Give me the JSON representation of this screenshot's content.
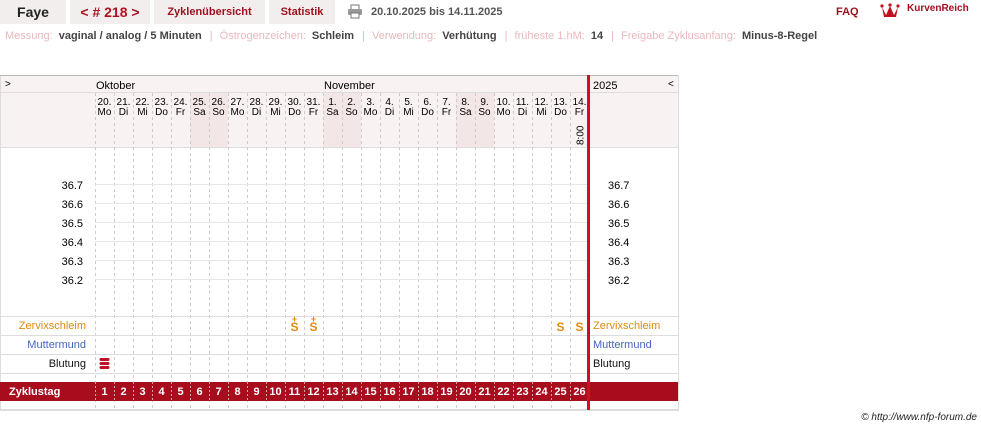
{
  "header": {
    "name": "Faye",
    "cycle_nav": "< # 218 >",
    "tabs": [
      "Zyklenübersicht",
      "Statistik"
    ],
    "date_range": "20.10.2025 bis 14.11.2025",
    "faq": "FAQ",
    "brand": "KurvenReich"
  },
  "info": [
    {
      "label": "Messung:",
      "value": "vaginal / analog / 5 Minuten"
    },
    {
      "label": "Östrogenzeichen:",
      "value": "Schleim"
    },
    {
      "label": "Verwendung:",
      "value": "Verhütung"
    },
    {
      "label": "früheste 1.hM:",
      "value": "14"
    },
    {
      "label": "Freigabe Zyklusanfang:",
      "value": "Minus-8-Regel"
    }
  ],
  "chart": {
    "nav_left": ">",
    "nav_right": "<",
    "year": "2025",
    "months": [
      {
        "label": "Oktober",
        "day_index": 0
      },
      {
        "label": "November",
        "day_index": 12
      }
    ],
    "days": [
      {
        "d": "20.",
        "w": "Mo"
      },
      {
        "d": "21.",
        "w": "Di"
      },
      {
        "d": "22.",
        "w": "Mi"
      },
      {
        "d": "23.",
        "w": "Do"
      },
      {
        "d": "24.",
        "w": "Fr"
      },
      {
        "d": "25.",
        "w": "Sa",
        "we": true
      },
      {
        "d": "26.",
        "w": "So",
        "we": true
      },
      {
        "d": "27.",
        "w": "Mo"
      },
      {
        "d": "28.",
        "w": "Di"
      },
      {
        "d": "29.",
        "w": "Mi"
      },
      {
        "d": "30.",
        "w": "Do"
      },
      {
        "d": "31.",
        "w": "Fr"
      },
      {
        "d": "1.",
        "w": "Sa",
        "we": true
      },
      {
        "d": "2.",
        "w": "So",
        "we": true
      },
      {
        "d": "3.",
        "w": "Mo"
      },
      {
        "d": "4.",
        "w": "Di"
      },
      {
        "d": "5.",
        "w": "Mi"
      },
      {
        "d": "6.",
        "w": "Do"
      },
      {
        "d": "7.",
        "w": "Fr"
      },
      {
        "d": "8.",
        "w": "Sa",
        "we": true
      },
      {
        "d": "9.",
        "w": "So",
        "we": true
      },
      {
        "d": "10.",
        "w": "Mo"
      },
      {
        "d": "11.",
        "w": "Di"
      },
      {
        "d": "12.",
        "w": "Mi"
      },
      {
        "d": "13.",
        "w": "Do"
      },
      {
        "d": "14.",
        "w": "Fr",
        "time": "8:00"
      }
    ],
    "temp_labels": [
      "36.7",
      "36.6",
      "36.5",
      "36.4",
      "36.3",
      "36.2"
    ],
    "rows": {
      "mucus": "Zervixschleim",
      "cervix": "Muttermund",
      "bleeding": "Blutung",
      "cycle_day": "Zyklustag"
    },
    "mucus_marks": [
      {
        "day_index": 10,
        "symbol": "S",
        "plus": true
      },
      {
        "day_index": 11,
        "symbol": "S",
        "plus": true
      },
      {
        "day_index": 24,
        "symbol": "S"
      },
      {
        "day_index": 25,
        "symbol": "S"
      }
    ],
    "bleeding_days": [
      0
    ],
    "cycle_days": [
      "1",
      "2",
      "3",
      "4",
      "5",
      "6",
      "7",
      "8",
      "9",
      "10",
      "11",
      "12",
      "13",
      "14",
      "15",
      "16",
      "17",
      "18",
      "19",
      "20",
      "21",
      "22",
      "23",
      "24",
      "25",
      "26"
    ],
    "colors": {
      "accent": "#a80d1e",
      "mucus": "#e08a10",
      "cervix": "#4466bb",
      "weekend": "#f3e6e6"
    }
  },
  "footer": "© http://www.nfp-forum.de"
}
